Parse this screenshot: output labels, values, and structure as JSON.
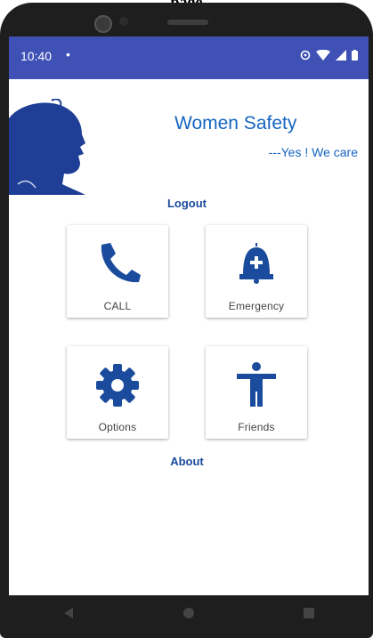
{
  "page": {
    "caption": "page"
  },
  "statusbar": {
    "time": "10:40",
    "dot": "•",
    "bar_color": "#3f51b5"
  },
  "header": {
    "title": "Women Safety",
    "tagline": "---Yes ! We care"
  },
  "links": {
    "logout": "Logout",
    "about": "About"
  },
  "cards": [
    {
      "id": "call",
      "label": "CALL",
      "icon": "phone-icon"
    },
    {
      "id": "emergency",
      "label": "Emergency",
      "icon": "alarm-bell-plus-icon"
    },
    {
      "id": "options",
      "label": "Options",
      "icon": "gear-icon"
    },
    {
      "id": "friends",
      "label": "Friends",
      "icon": "person-icon"
    }
  ],
  "colors": {
    "accent": "#1a4b9c",
    "title": "#1565c0"
  },
  "navbar": {
    "back": "back-icon",
    "home": "home-icon",
    "recents": "recents-icon"
  }
}
